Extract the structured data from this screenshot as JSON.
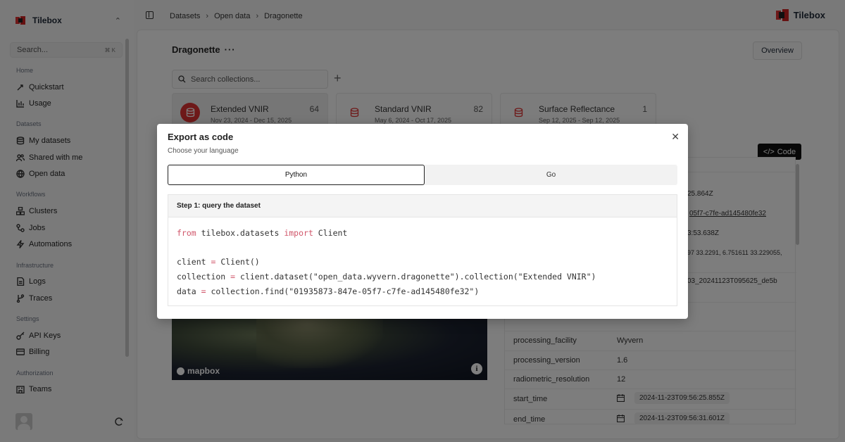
{
  "sidebar": {
    "org_name": "Tilebox",
    "search_placeholder": "Search...",
    "search_shortcut": "⌘ K",
    "sections": {
      "home": "Home",
      "datasets": "Datasets",
      "workflows": "Workflows",
      "infrastructure": "Infrastructure",
      "settings": "Settings",
      "authorization": "Authorization"
    },
    "items": {
      "quickstart": "Quickstart",
      "usage": "Usage",
      "my_datasets": "My datasets",
      "shared_with_me": "Shared with me",
      "open_data": "Open data",
      "clusters": "Clusters",
      "jobs": "Jobs",
      "automations": "Automations",
      "logs": "Logs",
      "traces": "Traces",
      "api_keys": "API Keys",
      "billing": "Billing",
      "teams": "Teams"
    }
  },
  "topbar": {
    "breadcrumb": [
      "Datasets",
      "Open data",
      "Dragonette"
    ],
    "brand": "Tilebox"
  },
  "main": {
    "title": "Dragonette",
    "more": "···",
    "overview_label": "Overview",
    "collection_search_placeholder": "Search collections...",
    "collections": [
      {
        "name": "Extended VNIR",
        "count": "64",
        "dates": "Nov 23, 2024 - Dec 15, 2025"
      },
      {
        "name": "Standard VNIR",
        "count": "82",
        "dates": "May 6, 2024 - Oct 17, 2025"
      },
      {
        "name": "Surface Reflectance",
        "count": "1",
        "dates": "Sep 12, 2025 - Sep 12, 2025"
      }
    ],
    "code_button": "Code",
    "map_logo": "mapbox",
    "map_info": "i",
    "partial_values": [
      "25.864Z",
      "05f7-c7fe-ad145480fe32",
      "3:53.638Z",
      "97 33.2291, 6.751611 33.229055,",
      "03_20241123T095625_de5b"
    ],
    "properties": [
      {
        "key": "processing_facility",
        "value": "Wyvern"
      },
      {
        "key": "processing_version",
        "value": "1.6"
      },
      {
        "key": "radiometric_resolution",
        "value": "12"
      },
      {
        "key": "start_time",
        "value": "2024-11-23T09:56:25.855Z"
      },
      {
        "key": "end_time",
        "value": "2024-11-23T09:56:31.601Z"
      }
    ]
  },
  "modal": {
    "title": "Export as code",
    "subtitle": "Choose your language",
    "tabs": [
      "Python",
      "Go"
    ],
    "selected_tab": "Python",
    "step_title": "Step 1: query the dataset",
    "code": {
      "line1_kw1": "from",
      "line1_mid": " tilebox.datasets ",
      "line1_kw2": "import",
      "line1_end": " Client",
      "line3_a": "client ",
      "line3_op": "=",
      "line3_b": " Client()",
      "line4_a": "collection ",
      "line4_op": "=",
      "line4_b": " client.dataset(\"open_data.wyvern.dragonette\").collection(\"Extended VNIR\")",
      "line5_a": "data ",
      "line5_op": "=",
      "line5_b": " collection.find(\"01935873-847e-05f7-c7fe-ad145480fe32\")"
    }
  },
  "colors": {
    "accent_red": "#d33333",
    "code_keyword": "#d0566a",
    "code_button_bg": "#111111"
  }
}
